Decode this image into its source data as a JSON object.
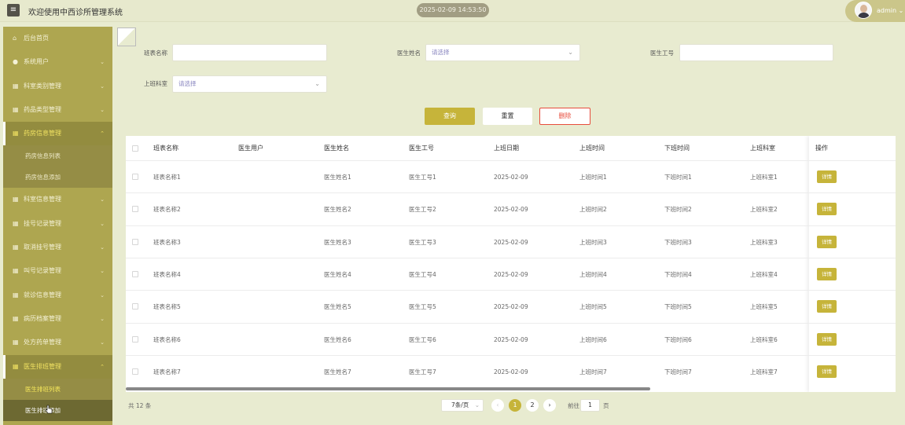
{
  "header": {
    "menu_icon": "hamburger-icon",
    "title": "欢迎使用中西诊所管理系统",
    "datetime": "2025-02-09 14:53:50",
    "user": "admin",
    "user_caret": "⌄"
  },
  "sidebar": {
    "items": [
      {
        "label": "后台首页",
        "icon": "home-icon",
        "glyph": "⌂",
        "chevron": ""
      },
      {
        "label": "系统用户",
        "icon": "user-icon",
        "glyph": "●",
        "chevron": "⌄"
      },
      {
        "label": "科室类别管理",
        "icon": "grid-icon",
        "glyph": "▦",
        "chevron": "⌄"
      },
      {
        "label": "药品类型管理",
        "icon": "grid-icon",
        "glyph": "▦",
        "chevron": "⌄"
      },
      {
        "label": "药房信息管理",
        "icon": "grid-icon",
        "glyph": "▦",
        "chevron": "⌃"
      },
      {
        "label": "药房信息列表"
      },
      {
        "label": "药房信息添加"
      },
      {
        "label": "科室信息管理",
        "icon": "grid-icon",
        "glyph": "▦",
        "chevron": "⌄"
      },
      {
        "label": "挂号记录管理",
        "icon": "grid-icon",
        "glyph": "▦",
        "chevron": "⌄"
      },
      {
        "label": "取消挂号管理",
        "icon": "grid-icon",
        "glyph": "▦",
        "chevron": "⌄"
      },
      {
        "label": "叫号记录管理",
        "icon": "grid-icon",
        "glyph": "▦",
        "chevron": "⌄"
      },
      {
        "label": "就诊信息管理",
        "icon": "grid-icon",
        "glyph": "▦",
        "chevron": "⌄"
      },
      {
        "label": "病历档案管理",
        "icon": "grid-icon",
        "glyph": "▦",
        "chevron": "⌄"
      },
      {
        "label": "处方药单管理",
        "icon": "grid-icon",
        "glyph": "▦",
        "chevron": "⌄"
      },
      {
        "label": "医生排班管理",
        "icon": "grid-icon",
        "glyph": "▦",
        "chevron": "⌃"
      },
      {
        "label": "医生排班列表"
      },
      {
        "label": "医生排班添加"
      }
    ]
  },
  "search": {
    "shift_name_label": "班表名称",
    "shift_name_value": "",
    "doctor_name_label": "医生姓名",
    "doctor_name_placeholder": "请选择",
    "doctor_id_label": "医生工号",
    "doctor_id_value": "",
    "dept_label": "上班科室",
    "dept_placeholder": "请选择",
    "dropdown_glyph": "⌄",
    "search_button": "查询",
    "reset_button": "重置",
    "delete_button": "删除"
  },
  "table": {
    "columns": [
      "班表名称",
      "医生用户",
      "医生姓名",
      "医生工号",
      "上班日期",
      "上班时间",
      "下班时间",
      "上班科室",
      "操作"
    ],
    "detail_label": "详情",
    "rows": [
      [
        "班表名称1",
        "",
        "医生姓名1",
        "医生工号1",
        "2025-02-09",
        "上班时间1",
        "下班时间1",
        "上班科室1"
      ],
      [
        "班表名称2",
        "",
        "医生姓名2",
        "医生工号2",
        "2025-02-09",
        "上班时间2",
        "下班时间2",
        "上班科室2"
      ],
      [
        "班表名称3",
        "",
        "医生姓名3",
        "医生工号3",
        "2025-02-09",
        "上班时间3",
        "下班时间3",
        "上班科室3"
      ],
      [
        "班表名称4",
        "",
        "医生姓名4",
        "医生工号4",
        "2025-02-09",
        "上班时间4",
        "下班时间4",
        "上班科室4"
      ],
      [
        "班表名称5",
        "",
        "医生姓名5",
        "医生工号5",
        "2025-02-09",
        "上班时间5",
        "下班时间5",
        "上班科室5"
      ],
      [
        "班表名称6",
        "",
        "医生姓名6",
        "医生工号6",
        "2025-02-09",
        "上班时间6",
        "下班时间6",
        "上班科室6"
      ],
      [
        "班表名称7",
        "",
        "医生姓名7",
        "医生工号7",
        "2025-02-09",
        "上班时间7",
        "下班时间7",
        "上班科室7"
      ]
    ]
  },
  "pagination": {
    "total": "共 12 条",
    "page_size": "7条/页",
    "page_size_glyph": "⌄",
    "prev": "‹",
    "next": "›",
    "pages": [
      "1",
      "2"
    ],
    "current_page": "1",
    "goto_label": "前往",
    "goto_value": "1",
    "goto_suffix": "页"
  },
  "colors": {
    "sidebar": "#aea650",
    "accent": "#c6b43a",
    "active_text": "#f1e262",
    "danger": "#e74c3c"
  }
}
